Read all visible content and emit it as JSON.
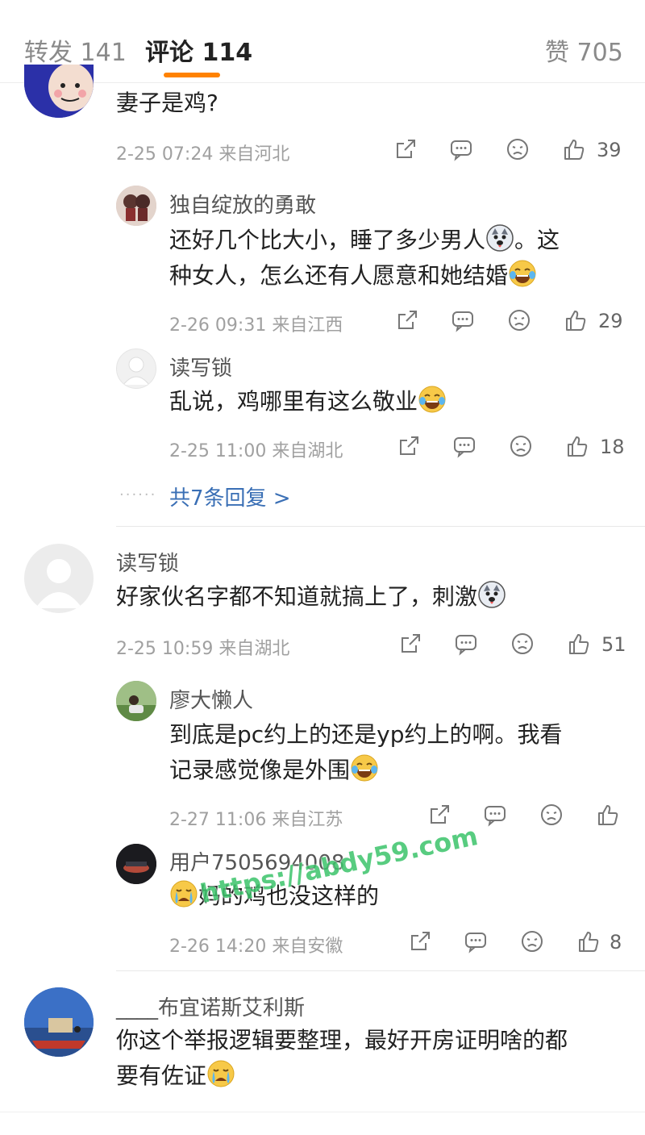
{
  "tabs": {
    "repost": "转发 141",
    "comments": "评论 114",
    "likes": "赞 705"
  },
  "comments": [
    {
      "text": "妻子是鸡?",
      "date": "2-25 07:24",
      "location": "来自河北",
      "likes": "39",
      "replies": [
        {
          "name": "独自绽放的勇敢",
          "text1": "还好几个比大小，睡了多少男人",
          "text1b": "。这",
          "text2": "种女人，怎么还有人愿意和她结婚",
          "date": "2-26 09:31",
          "location": "来自江西",
          "likes": "29"
        },
        {
          "name": "读写锁",
          "text": "乱说，鸡哪里有这么敬业",
          "date": "2-25 11:00",
          "location": "来自湖北",
          "likes": "18"
        }
      ],
      "more": "共7条回复 >"
    },
    {
      "name": "读写锁",
      "text": "好家伙名字都不知道就搞上了，刺激",
      "date": "2-25 10:59",
      "location": "来自湖北",
      "likes": "51",
      "replies": [
        {
          "name": "廖大懒人",
          "text1": "到底是pc约上的还是yp约上的啊。我看",
          "text2": "记录感觉像是外围",
          "date": "2-27 11:06",
          "location": "来自江苏",
          "likes": ""
        },
        {
          "name": "用户7505694008",
          "text": "妈的鸡也没这样的",
          "date": "2-26 14:20",
          "location": "来自安徽",
          "likes": "8"
        }
      ]
    },
    {
      "name": "____布宜诺斯艾利斯",
      "text1": "你这个举报逻辑要整理，最好开房证明啥的都",
      "text2": "要有佐证"
    }
  ],
  "watermark": "https://abdy59.com",
  "colors": {
    "accent": "#ff8200",
    "link": "#3a6fb5",
    "watermark": "#3cc46b"
  }
}
